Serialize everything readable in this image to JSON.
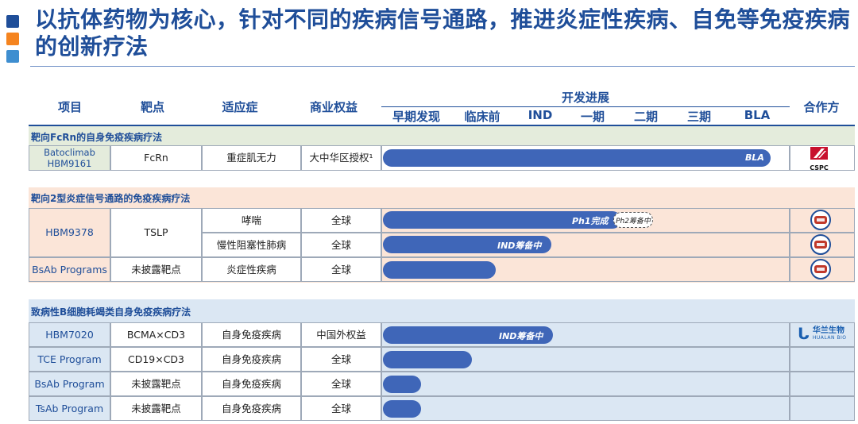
{
  "title": "以抗体药物为核心，针对不同的疾病信号通路，推进炎症性疾病、自免等免疫疾病的创新疗法",
  "colors": {
    "sq1": "#1f4e99",
    "sq2": "#f5841f",
    "sq3": "#3e8ed0",
    "bar": "#3f66b8"
  },
  "headers": {
    "project": "项目",
    "target": "靶点",
    "indication": "适应症",
    "rights": "商业权益",
    "progress": "开发进展",
    "partner": "合作方",
    "stages": [
      "早期发现",
      "临床前",
      "IND",
      "一期",
      "二期",
      "三期",
      "BLA"
    ]
  },
  "sections": [
    {
      "title": "靶向FcRn的自身免疫疾病疗法",
      "rows": [
        {
          "project": "Batoclimab\nHBM9161",
          "target": "FcRn",
          "indication": "重症肌无力",
          "rights": "大中华区授权¹",
          "progress": 0.95,
          "bar_label": "BLA",
          "partner_logo": "cspc-logo",
          "partner_text": "CSPC"
        }
      ]
    },
    {
      "title": "靶向2型炎症信号通路的免疫疾病疗法",
      "rows": [
        {
          "project": "HBM9378",
          "target": "TSLP",
          "indication": "哮喘",
          "rights": "全球",
          "progress": 0.58,
          "bar_label": "Ph1完成",
          "next_label": "Ph2筹备中",
          "partner_logo": "kelun-seal"
        },
        {
          "project": "",
          "target": "",
          "indication": "慢性阻塞性肺病",
          "rights": "全球",
          "progress": 0.42,
          "bar_label": "IND筹备中",
          "partner_logo": "kelun-seal"
        },
        {
          "project": "BsAb Programs",
          "target": "未披露靶点",
          "indication": "炎症性疾病",
          "rights": "全球",
          "progress": 0.28,
          "bar_label": "",
          "partner_logo": "kelun-seal"
        }
      ]
    },
    {
      "title": "致病性B细胞耗竭类自身免疫疾病疗法",
      "rows": [
        {
          "project": "HBM7020",
          "target": "BCMA×CD3",
          "indication": "自身免疫疾病",
          "rights": "中国外权益",
          "progress": 0.42,
          "bar_label": "IND筹备中",
          "partner_logo": "hualan-logo",
          "partner_text": "华兰生物",
          "partner_sub": "HUALAN BIO"
        },
        {
          "project": "TCE Program",
          "target": "CD19×CD3",
          "indication": "自身免疫疾病",
          "rights": "全球",
          "progress": 0.22,
          "bar_label": ""
        },
        {
          "project": "BsAb Program",
          "target": "未披露靶点",
          "indication": "自身免疫疾病",
          "rights": "全球",
          "progress": 0.1,
          "bar_label": ""
        },
        {
          "project": "TsAb Program",
          "target": "未披露靶点",
          "indication": "自身免疫疾病",
          "rights": "全球",
          "progress": 0.1,
          "bar_label": ""
        }
      ]
    }
  ]
}
